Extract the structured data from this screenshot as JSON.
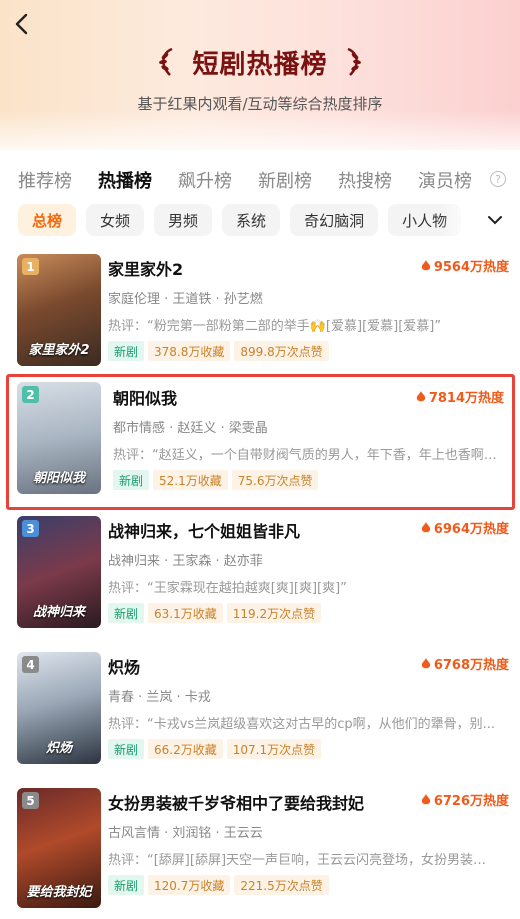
{
  "header": {
    "title": "短剧热播榜",
    "subtitle": "基于红果内观看/互动等综合热度排序"
  },
  "tabs": [
    {
      "label": "推荐榜"
    },
    {
      "label": "热播榜"
    },
    {
      "label": "飙升榜"
    },
    {
      "label": "新剧榜"
    },
    {
      "label": "热搜榜"
    },
    {
      "label": "演员榜"
    }
  ],
  "filters": [
    {
      "label": "总榜"
    },
    {
      "label": "女频"
    },
    {
      "label": "男频"
    },
    {
      "label": "系统"
    },
    {
      "label": "奇幻脑洞"
    },
    {
      "label": "小人物"
    }
  ],
  "rank_colors": {
    "1": "#e8b062",
    "2": "#4fbfa7",
    "3": "#4b8fd8",
    "4": "#8a8a8a",
    "5": "#8a8a8a"
  },
  "items": [
    {
      "rank": "1",
      "name": "家里家外2",
      "heat": "9564万热度",
      "tags": "家庭伦理 · 王道铁 · 孙艺燃",
      "comment": "热评：“粉完第一部粉第二部的举手🙌[爱慕][爱慕][爱慕]”",
      "badge": "新剧",
      "collect": "378.8万收藏",
      "likes": "899.8万次点赞",
      "poster_caption": "家里家外2"
    },
    {
      "rank": "2",
      "name": "朝阳似我",
      "heat": "7814万热度",
      "tags": "都市情感 · 赵廷义 · 梁雯晶",
      "comment": "热评：“赵廷义，一个自带财阀气质的男人，年下香，年上也香啊[...",
      "badge": "新剧",
      "collect": "52.1万收藏",
      "likes": "75.6万次点赞",
      "poster_caption": "朝阳似我"
    },
    {
      "rank": "3",
      "name": "战神归来，七个姐姐皆非凡",
      "heat": "6964万热度",
      "tags": "战神归来 · 王家森 · 赵亦菲",
      "comment": "热评：“王家霖现在越拍越爽[爽][爽][爽]”",
      "badge": "新剧",
      "collect": "63.1万收藏",
      "likes": "119.2万次点赞",
      "poster_caption": "战神归来"
    },
    {
      "rank": "4",
      "name": "炽炀",
      "heat": "6768万热度",
      "tags": "青春 · 兰岚 · 卡戎",
      "comment": "热评：“卡戎vs兰岚超级喜欢这对古早的cp啊，从他们的犟骨，别...",
      "badge": "新剧",
      "collect": "66.2万收藏",
      "likes": "107.1万次点赞",
      "poster_caption": "炽炀"
    },
    {
      "rank": "5",
      "name": "女扮男装被千岁爷相中了要给我封妃",
      "heat": "6726万热度",
      "tags": "古风言情 · 刘润铭 · 王云云",
      "comment": "热评：“[舔屏][舔屏]天空一声巨响，王云云闪亮登场，女扮男装又...",
      "badge": "新剧",
      "collect": "120.7万收藏",
      "likes": "221.5万次点赞",
      "poster_caption": "要给我封妃"
    }
  ]
}
